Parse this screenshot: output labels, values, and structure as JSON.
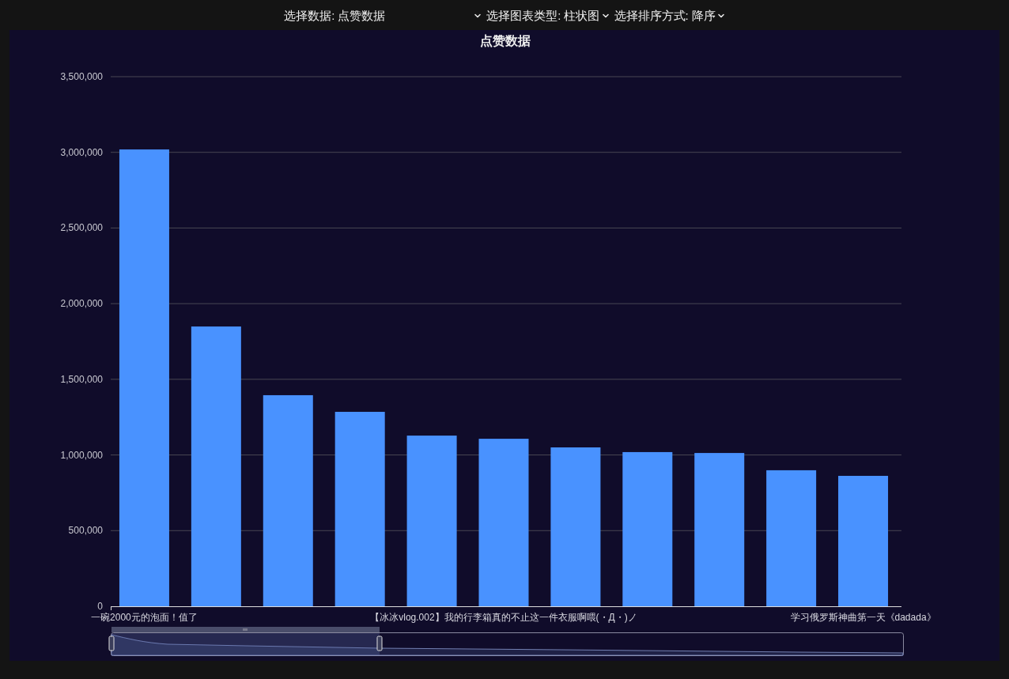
{
  "selectors": [
    {
      "label": "选择数据: 点赞数据"
    },
    {
      "label": "选择图表类型: 柱状图"
    },
    {
      "label": "选择排序方式: 降序"
    }
  ],
  "chart": {
    "chart_data": {
      "type": "bar",
      "title": "点赞数据",
      "grid": true,
      "categories": [
        "一碗2000元的泡面！值了",
        null,
        null,
        null,
        null,
        "【冰冰vlog.002】我的行李箱真的不止这一件衣服啊喂(・Д・)ノ",
        null,
        null,
        null,
        null,
        "学习俄罗斯神曲第一天《dadada》"
      ],
      "series": [
        {
          "color": "#4992ff",
          "values": [
            3019000,
            1849000,
            1395000,
            1285000,
            1128000,
            1107000,
            1050000,
            1019000,
            1013000,
            899000,
            862000
          ]
        }
      ],
      "ylim": [
        0,
        3500000
      ],
      "yticks": [
        {
          "value": 0,
          "label": "0"
        },
        {
          "value": 500000,
          "label": "500,000"
        },
        {
          "value": 1000000,
          "label": "1,000,000"
        },
        {
          "value": 1500000,
          "label": "1,500,000"
        },
        {
          "value": 2000000,
          "label": "2,000,000"
        },
        {
          "value": 2500000,
          "label": "2,500,000"
        },
        {
          "value": 3000000,
          "label": "3,000,000"
        },
        {
          "value": 3500000,
          "label": "3,500,000"
        }
      ]
    }
  }
}
